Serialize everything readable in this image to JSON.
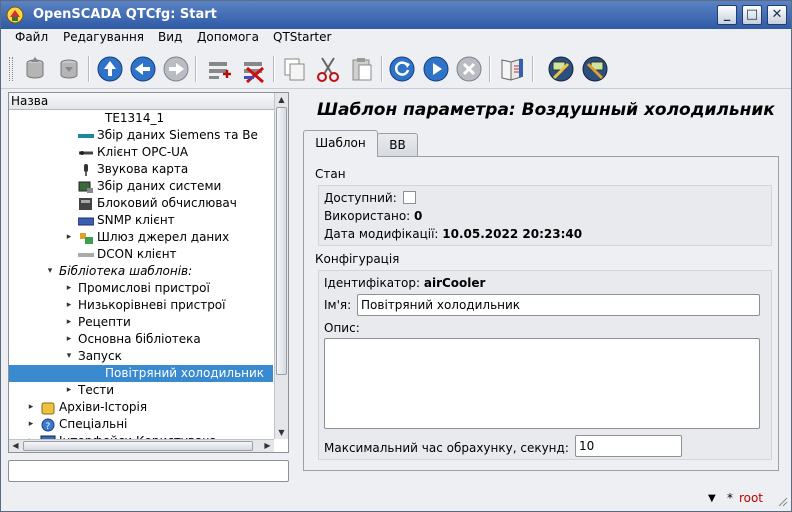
{
  "window": {
    "title": "OpenSCADA QTCfg: Start",
    "minimize": "_",
    "maximize": "□",
    "close": "✕"
  },
  "menu": [
    "Файл",
    "Редагування",
    "Вид",
    "Допомога",
    "QTStarter"
  ],
  "toolbar": {
    "icons": [
      "db-load-icon",
      "db-save-icon",
      "up-icon",
      "back-icon",
      "forward-icon",
      "add-item-icon",
      "delete-item-icon",
      "copy-icon",
      "cut-icon",
      "paste-icon",
      "refresh-icon",
      "start-icon",
      "stop-icon",
      "manual-icon",
      "settings-icon",
      "settings-alt-icon"
    ]
  },
  "tree": {
    "header": "Назва",
    "rows": [
      {
        "label": "TE1314_1",
        "level": 4,
        "arrow": "",
        "icon": "",
        "italic": false,
        "selected": false
      },
      {
        "label": "Збір даних Siemens та Be",
        "level": 3,
        "arrow": "",
        "icon": "siemens-icon",
        "italic": false,
        "selected": false
      },
      {
        "label": "Клієнт OPC-UA",
        "level": 3,
        "arrow": "",
        "icon": "opc-icon",
        "italic": false,
        "selected": false
      },
      {
        "label": "Звукова карта",
        "level": 3,
        "arrow": "",
        "icon": "microphone-icon",
        "italic": false,
        "selected": false
      },
      {
        "label": "Збір даних системи",
        "level": 3,
        "arrow": "",
        "icon": "system-icon",
        "italic": false,
        "selected": false
      },
      {
        "label": "Блоковий обчислювач",
        "level": 3,
        "arrow": "",
        "icon": "block-calc-icon",
        "italic": false,
        "selected": false
      },
      {
        "label": "SNMP клієнт",
        "level": 3,
        "arrow": "",
        "icon": "snmp-icon",
        "italic": false,
        "selected": false
      },
      {
        "label": "Шлюз джерел даних",
        "level": 3,
        "arrow": "▸",
        "icon": "gateway-icon",
        "italic": false,
        "selected": false
      },
      {
        "label": "DCON клієнт",
        "level": 3,
        "arrow": "",
        "icon": "dcon-icon",
        "italic": false,
        "selected": false
      },
      {
        "label": "Бібліотека шаблонів:",
        "level": 2,
        "arrow": "▾",
        "icon": "",
        "italic": true,
        "selected": false
      },
      {
        "label": "Промислові пристрої",
        "level": 3,
        "arrow": "▸",
        "icon": "",
        "italic": false,
        "selected": false
      },
      {
        "label": "Низькорівневі пристрої",
        "level": 3,
        "arrow": "▸",
        "icon": "",
        "italic": false,
        "selected": false
      },
      {
        "label": "Рецепти",
        "level": 3,
        "arrow": "▸",
        "icon": "",
        "italic": false,
        "selected": false
      },
      {
        "label": "Основна бібліотека",
        "level": 3,
        "arrow": "▸",
        "icon": "",
        "italic": false,
        "selected": false
      },
      {
        "label": "Запуск",
        "level": 3,
        "arrow": "▾",
        "icon": "",
        "italic": false,
        "selected": false
      },
      {
        "label": "Повітряний холодильник",
        "level": 4,
        "arrow": "",
        "icon": "",
        "italic": false,
        "selected": true
      },
      {
        "label": "Тести",
        "level": 3,
        "arrow": "▸",
        "icon": "",
        "italic": false,
        "selected": false
      },
      {
        "label": "Архіви-Історія",
        "level": 1,
        "arrow": "▸",
        "icon": "archive-icon",
        "italic": false,
        "selected": false
      },
      {
        "label": "Спеціальні",
        "level": 1,
        "arrow": "▸",
        "icon": "help-icon",
        "italic": false,
        "selected": false
      },
      {
        "label": "Інтерфейси Користувача",
        "level": 1,
        "arrow": "▸",
        "icon": "monitor-icon",
        "italic": false,
        "selected": false
      }
    ]
  },
  "left_input": {
    "value": ""
  },
  "main": {
    "title": "Шаблон параметра: Воздушный холодильник",
    "tabs": [
      {
        "label": "Шаблон"
      },
      {
        "label": "ВВ"
      }
    ],
    "state": {
      "section": "Стан",
      "enabled_label": "Доступний:",
      "enabled": false,
      "used_label": "Використано:",
      "used_value": "0",
      "modified_label": "Дата модифікації:",
      "modified_value": "10.05.2022 20:23:40"
    },
    "config": {
      "section": "Конфігурація",
      "id_label": "Ідентифікатор:",
      "id_value": "airCooler",
      "name_label": "Ім'я:",
      "name_value": "Повітряний холодильник",
      "descr_label": "Опис:",
      "descr_value": "",
      "maxcalc_label": "Максимальний час обрахунку, секунд:",
      "maxcalc_value": "10"
    }
  },
  "status": {
    "user": "root",
    "marker": "*"
  },
  "colors": {
    "selection": "#3a8ad0",
    "title_bar": "#2f5aa5",
    "user": "#c00000"
  }
}
